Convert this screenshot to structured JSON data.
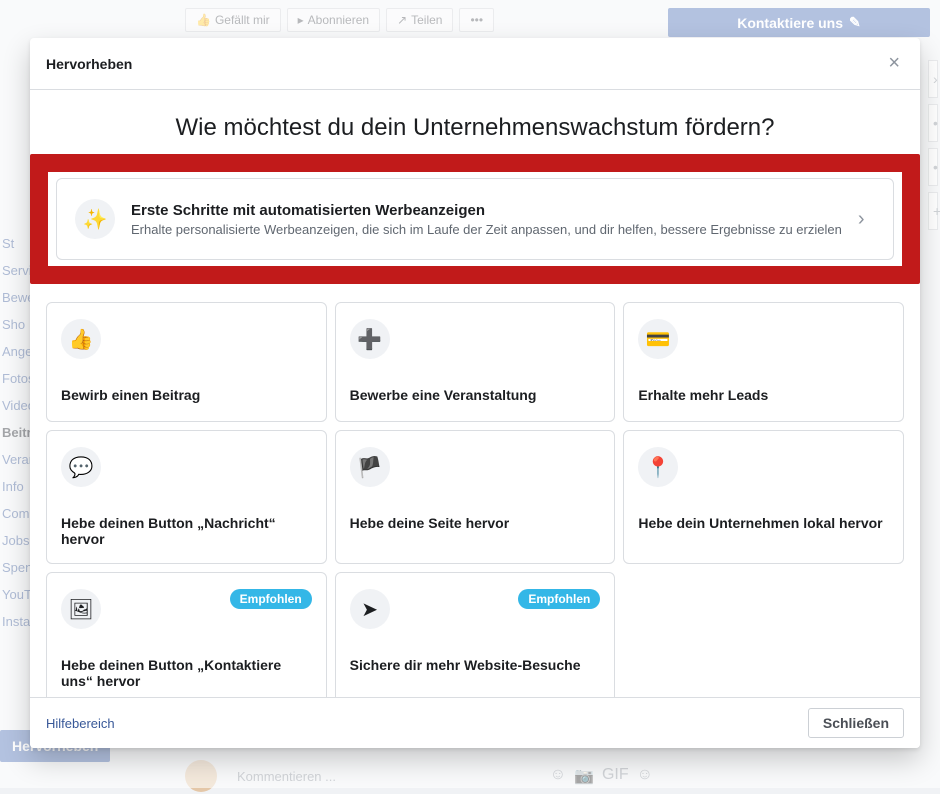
{
  "topbar": {
    "like": "Gefällt mir",
    "subscribe": "Abonnieren",
    "share": "Teilen",
    "cta": "Kontaktiere uns"
  },
  "sidebar": {
    "items": [
      "St",
      "Servi",
      "Bewe",
      "Sho",
      "Ange",
      "Fotos",
      "Video",
      "Beitr",
      "Veran",
      "Info",
      "Com",
      "Jobs",
      "Spen",
      "YouT",
      "Insta"
    ],
    "active_index": 7
  },
  "primary_button": "Hervorheben",
  "comment": {
    "placeholder": "Kommentieren ..."
  },
  "modal": {
    "title": "Hervorheben",
    "question": "Wie möchtest du dein Unternehmenswachstum fördern?",
    "hero": {
      "title": "Erste Schritte mit automatisierten Werbeanzeigen",
      "desc": "Erhalte personalisierte Werbeanzeigen, die sich im Laufe der Zeit anpassen, und dir helfen, bessere Ergebnisse zu erzielen"
    },
    "recommended_label": "Empfohlen",
    "cards": [
      {
        "icon": "👍",
        "title": "Bewirb einen Beitrag"
      },
      {
        "icon": "➕",
        "title": "Bewerbe eine Veranstaltung"
      },
      {
        "icon": "💳",
        "title": "Erhalte mehr Leads"
      },
      {
        "icon": "💬",
        "title": "Hebe deinen Button „Nachricht“ hervor"
      },
      {
        "icon": "🏴",
        "title": "Hebe deine Seite hervor"
      },
      {
        "icon": "📍",
        "title": "Hebe dein Unternehmen lokal hervor"
      },
      {
        "icon": "🖼",
        "title": "Hebe deinen Button „Kontaktiere uns“ hervor",
        "recommended": true
      },
      {
        "icon": "➤",
        "title": "Sichere dir mehr Website-Besuche",
        "recommended": true
      }
    ],
    "help": "Hilfebereich",
    "close": "Schließen"
  }
}
